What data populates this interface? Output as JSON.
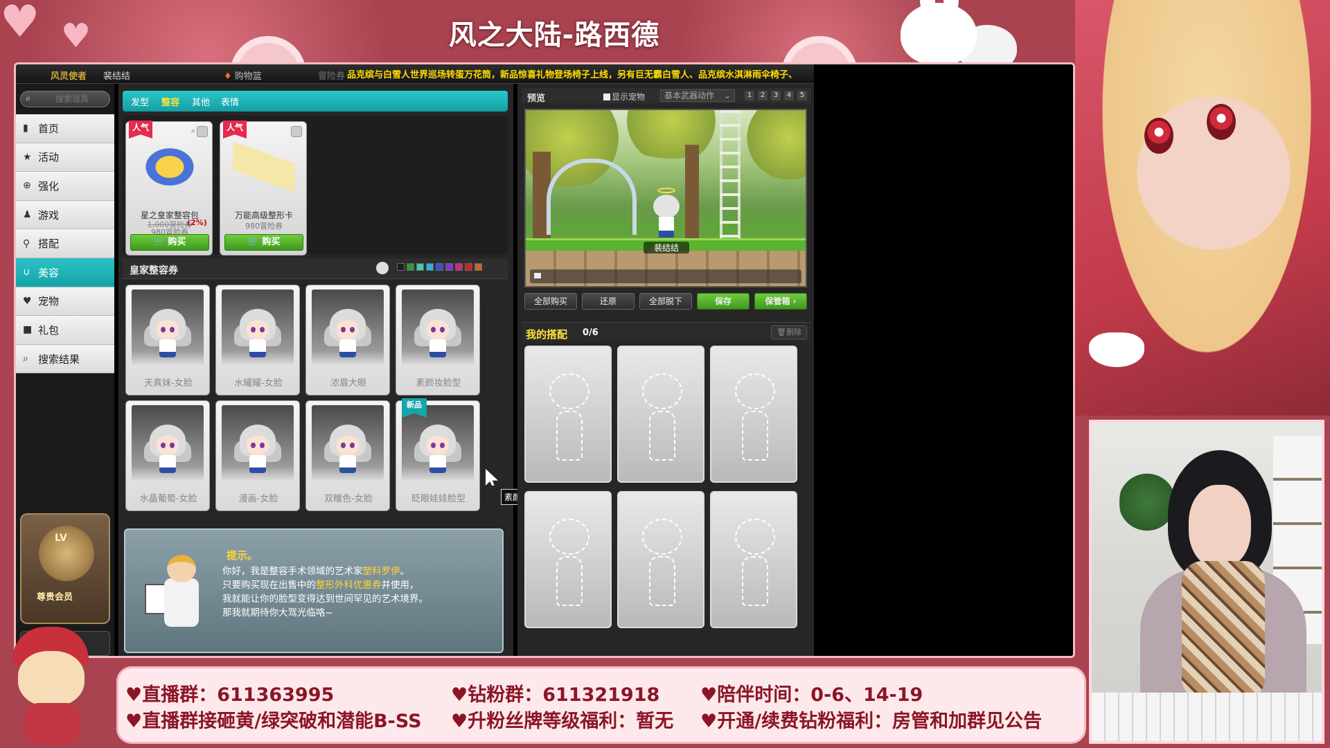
{
  "overlay": {
    "title": "风之大陆-路西德",
    "info": [
      "♥直播群：611363995",
      "♥钻粉群：611321918",
      "♥陪伴时间：0-6、14-19",
      "♥直播群接砸黄/绿突破和潜能B-SS",
      "♥升粉丝牌等级福利：暂无",
      "♥开通/续费钻粉福利：房管和加群见公告"
    ]
  },
  "game": {
    "topbar": {
      "user_title": "风灵使者",
      "user_name": "裴结结",
      "cart_label": "购物篮",
      "faded_tab": "冒险券",
      "ticker": "品克缤与白雪人世界巡场转蛋万花筒，新品惊喜礼物登场椅子上线，另有巨无霸白雪人、品克缤水淇淋雨伞椅子、"
    },
    "search": {
      "placeholder": "搜索道具",
      "icon": "search-icon"
    },
    "nav": [
      {
        "label": "首页",
        "icon": "bookmark-icon",
        "glyph": "▮"
      },
      {
        "label": "活动",
        "icon": "star-icon",
        "glyph": "★"
      },
      {
        "label": "强化",
        "icon": "plus-circle-icon",
        "glyph": "⊕"
      },
      {
        "label": "游戏",
        "icon": "joystick-icon",
        "glyph": "♟"
      },
      {
        "label": "搭配",
        "icon": "hanger-icon",
        "glyph": "⚲"
      },
      {
        "label": "美容",
        "icon": "magnet-icon",
        "glyph": "∪"
      },
      {
        "label": "宠物",
        "icon": "heart-icon",
        "glyph": "♥"
      },
      {
        "label": "礼包",
        "icon": "box-icon",
        "glyph": "■"
      },
      {
        "label": "搜索结果",
        "icon": "search-icon",
        "glyph": "⌕"
      }
    ],
    "active_nav": 5,
    "vip": {
      "level": "LV",
      "label": "尊贵会员"
    },
    "category_tabs": [
      "发型",
      "整容",
      "其他",
      "表情"
    ],
    "active_tab": 1,
    "featured": [
      {
        "badge": "人气",
        "name": "星之皇家整容包",
        "old_price": "1,000冒险券",
        "price": "980冒险券",
        "discount": "(2%)",
        "buy": "购买"
      },
      {
        "badge": "人气",
        "name": "万能高级整形卡",
        "old_price": "",
        "price": "980冒险券",
        "discount": "",
        "buy": "购买"
      }
    ],
    "section_title": "皇家整容券",
    "swatch_colors": [
      "#1e1e1e",
      "#2f9a3a",
      "#43c7b0",
      "#2bb0e6",
      "#3a4fc9",
      "#7b3ac9",
      "#c92a7b",
      "#c9272a",
      "#c9662a"
    ],
    "faces": [
      {
        "name": "天真妹-女脸",
        "badge": ""
      },
      {
        "name": "水耀耀-女脸",
        "badge": ""
      },
      {
        "name": "浓眉大眼",
        "badge": ""
      },
      {
        "name": "素颜妆脸型",
        "badge": ""
      },
      {
        "name": "水晶葡萄-女脸",
        "badge": ""
      },
      {
        "name": "漫画-女脸",
        "badge": ""
      },
      {
        "name": "双瞳色-女脸",
        "badge": ""
      },
      {
        "name": "眨眼娃娃脸型",
        "badge": "新品"
      }
    ],
    "tooltip": "素颜妆脸型",
    "tip": {
      "title": "提示。",
      "line1_a": "你好，我是整容手术领域的艺术家",
      "line1_hl": "塑料罗伊",
      "line1_b": "。",
      "line2_a": "只要购买现在出售中的",
      "line2_hl": "整形外科优惠券",
      "line2_b": "并使用，",
      "line3": "我就能让你的脸型变得达到世间罕见的艺术境界。",
      "line4": "那我就期待你大驾光临咯~"
    },
    "preview": {
      "title": "预览",
      "pet_toggle": "显示宠物",
      "weapon_action": "基本武器动作",
      "pages": [
        "1",
        "2",
        "3",
        "4",
        "5"
      ],
      "char_name": "裴结结",
      "buttons": [
        "全部购买",
        "还原",
        "全部脱下",
        "保存",
        "保管箱 ›"
      ]
    },
    "mystyle": {
      "title": "我的搭配",
      "count": "0/6",
      "delete": "🗑删除"
    }
  }
}
